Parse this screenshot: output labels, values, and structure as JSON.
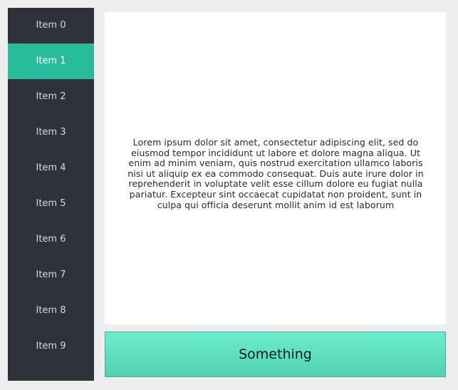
{
  "theme": {
    "page_background": "#eeeeee",
    "sidebar_background": "#2f3339",
    "sidebar_text": "#d7d9da",
    "accent_selected": "#27bd9c",
    "panel_background": "#ffffff",
    "button_gradient_top": "#6fecca",
    "button_gradient_bottom": "#52cfae",
    "button_border": "#3cb396",
    "button_text": "#15191b"
  },
  "sidebar": {
    "selected_index": 1,
    "items": [
      {
        "label": "Item 0"
      },
      {
        "label": "Item 1"
      },
      {
        "label": "Item 2"
      },
      {
        "label": "Item 3"
      },
      {
        "label": "Item 4"
      },
      {
        "label": "Item 5"
      },
      {
        "label": "Item 6"
      },
      {
        "label": "Item 7"
      },
      {
        "label": "Item 8"
      },
      {
        "label": "Item 9"
      }
    ]
  },
  "content": {
    "paragraph": "Lorem ipsum dolor sit amet, consectetur adipiscing elit, sed do eiusmod tempor incididunt ut labore et dolore magna aliqua. Ut enim ad minim veniam, quis nostrud exercitation ullamco laboris nisi ut aliquip ex ea commodo consequat. Duis aute irure dolor in reprehenderit in voluptate velit esse cillum dolore eu fugiat nulla pariatur. Excepteur sint occaecat cupidatat non proident, sunt in culpa qui officia deserunt mollit anim id est laborum"
  },
  "action": {
    "label": "Something"
  }
}
